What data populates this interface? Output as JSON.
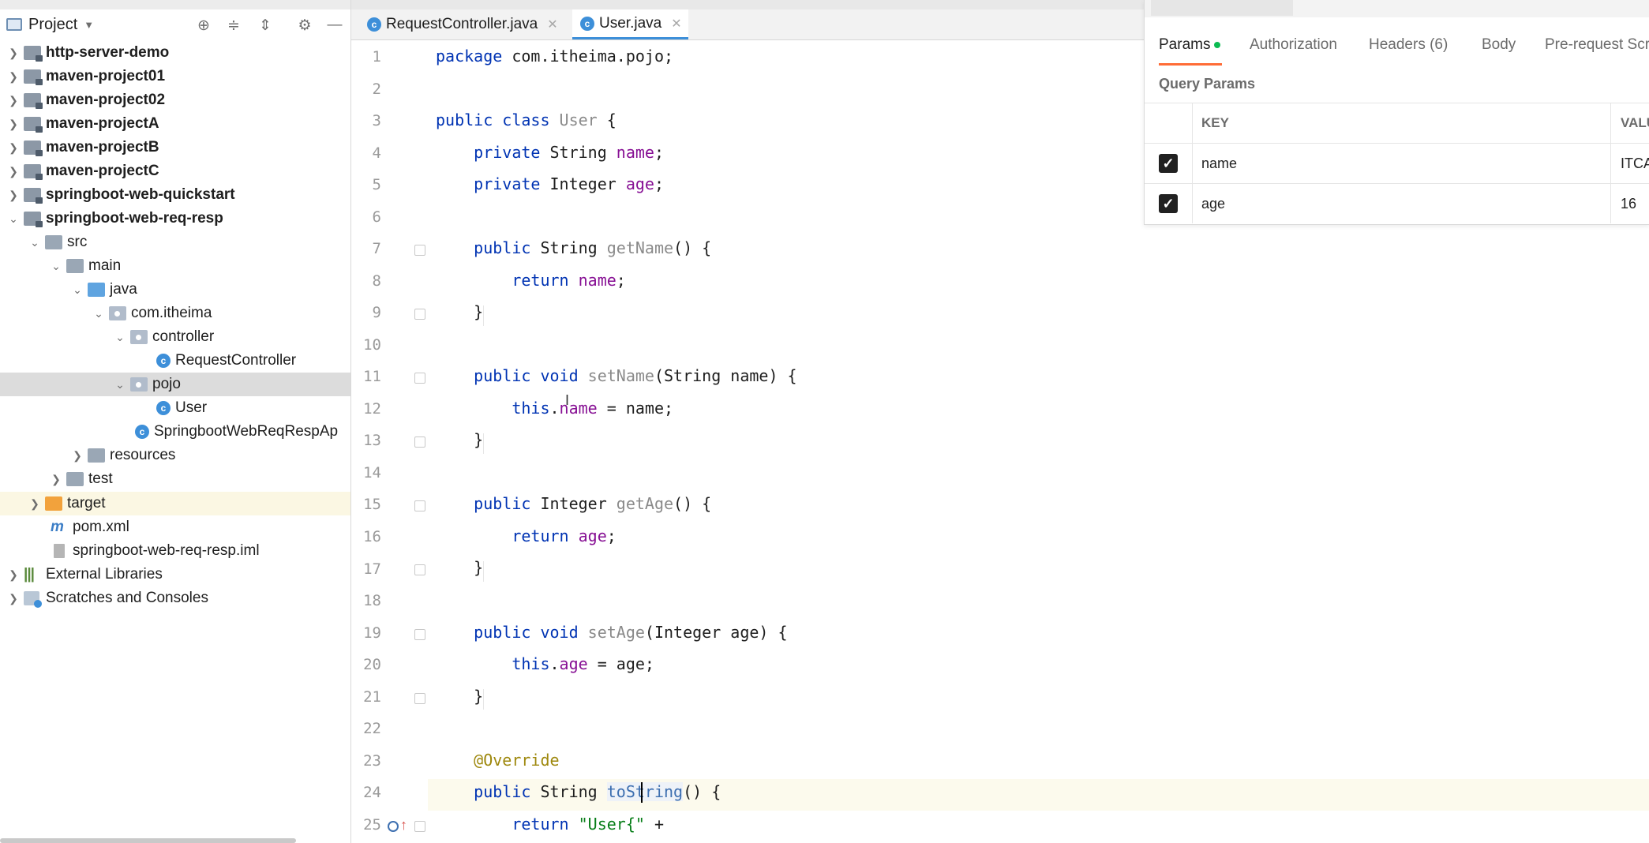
{
  "project_panel": {
    "title": "Project",
    "tree": [
      {
        "label": "http-server-demo",
        "bold": true
      },
      {
        "label": "maven-project01",
        "bold": true
      },
      {
        "label": "maven-project02",
        "bold": true
      },
      {
        "label": "maven-projectA",
        "bold": true
      },
      {
        "label": "maven-projectB",
        "bold": true
      },
      {
        "label": "maven-projectC",
        "bold": true
      },
      {
        "label": "springboot-web-quickstart",
        "bold": true
      },
      {
        "label": "springboot-web-req-resp",
        "bold": true
      },
      {
        "label": "src"
      },
      {
        "label": "main"
      },
      {
        "label": "java"
      },
      {
        "label": "com.itheima"
      },
      {
        "label": "controller"
      },
      {
        "label": "RequestController"
      },
      {
        "label": "pojo"
      },
      {
        "label": "User"
      },
      {
        "label": "SpringbootWebReqRespAp"
      },
      {
        "label": "resources"
      },
      {
        "label": "test"
      },
      {
        "label": "target"
      },
      {
        "label": "pom.xml"
      },
      {
        "label": "springboot-web-req-resp.iml"
      },
      {
        "label": "External Libraries"
      },
      {
        "label": "Scratches and Consoles"
      }
    ]
  },
  "editor": {
    "tabs": [
      {
        "label": "RequestController.java"
      },
      {
        "label": "User.java"
      }
    ],
    "line_numbers": [
      "1",
      "2",
      "3",
      "4",
      "5",
      "6",
      "7",
      "8",
      "9",
      "10",
      "11",
      "12",
      "13",
      "14",
      "15",
      "16",
      "17",
      "18",
      "19",
      "20",
      "21",
      "22",
      "23",
      "24",
      "25"
    ],
    "code": {
      "l1a": "package",
      "l1b": " com.itheima.pojo;",
      "l3a": "public class",
      "l3b": " User",
      "l3c": " {",
      "l4a": "    private",
      "l4b": " String ",
      "l4c": "name",
      "l4d": ";",
      "l5a": "    private",
      "l5b": " Integer ",
      "l5c": "age",
      "l5d": ";",
      "l7a": "    public",
      "l7b": " String ",
      "l7c": "getName",
      "l7d": "() {",
      "l8a": "        return",
      "l8b": " ",
      "l8c": "name",
      "l8d": ";",
      "l9": "    }",
      "l11a": "    public void",
      "l11b": " ",
      "l11c": "setName",
      "l11d": "(String name) {",
      "l12a": "        this",
      "l12b": ".",
      "l12c": "name",
      "l12d": " = name;",
      "l13": "    }",
      "l15a": "    public",
      "l15b": " Integer ",
      "l15c": "getAge",
      "l15d": "() {",
      "l16a": "        return",
      "l16b": " ",
      "l16c": "age",
      "l16d": ";",
      "l17": "    }",
      "l19a": "    public void",
      "l19b": " ",
      "l19c": "setAge",
      "l19d": "(Integer age) {",
      "l20a": "        this",
      "l20b": ".",
      "l20c": "age",
      "l20d": " = age;",
      "l21": "    }",
      "l23": "    @Override",
      "l24a": "    public",
      "l24b": " String ",
      "l24c": "toString",
      "l24d": "() {",
      "l25a": "        return",
      "l25b": " ",
      "l25c": "\"User{\"",
      "l25d": " +"
    }
  },
  "postman": {
    "tabs": [
      "Params",
      "Authorization",
      "Headers (6)",
      "Body",
      "Pre-request Scr"
    ],
    "section_title": "Query Params",
    "columns": {
      "key": "KEY",
      "value": "VALU"
    },
    "params": [
      {
        "key": "name",
        "value": "ITCA"
      },
      {
        "key": "age",
        "value": "16"
      }
    ],
    "colors": {
      "active_underline": "#ff6c37",
      "dot": "#0cbb52"
    }
  }
}
